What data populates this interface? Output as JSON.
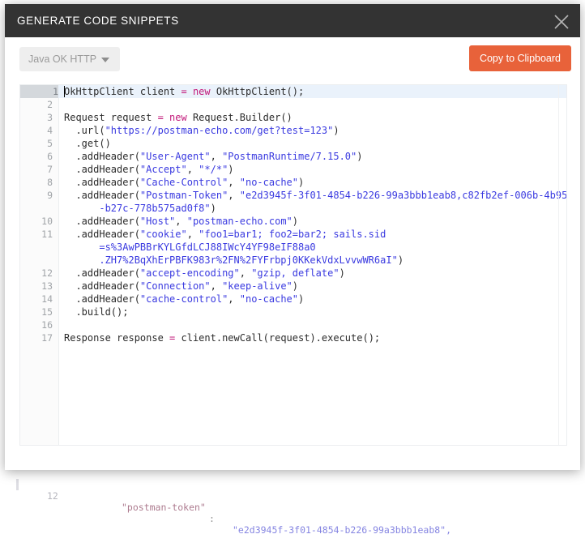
{
  "modal": {
    "title": "GENERATE CODE SNIPPETS",
    "close_icon": "close-icon"
  },
  "toolbar": {
    "language_selected": "Java OK HTTP",
    "language_caret_icon": "chevron-down-icon",
    "copy_label": "Copy to Clipboard",
    "accent_color": "#e8623a"
  },
  "editor": {
    "active_line": 1,
    "total_lines": 17,
    "lines": [
      {
        "num": "1",
        "active": true,
        "tokens": [
          {
            "t": "OkHttpClient client ",
            "c": "t-pln"
          },
          {
            "t": "= ",
            "c": "t-kw"
          },
          {
            "t": "new ",
            "c": "t-kw"
          },
          {
            "t": "OkHttpClient();",
            "c": "t-pln"
          }
        ]
      },
      {
        "num": "2",
        "active": false,
        "tokens": []
      },
      {
        "num": "3",
        "active": false,
        "tokens": [
          {
            "t": "Request request ",
            "c": "t-pln"
          },
          {
            "t": "= ",
            "c": "t-kw"
          },
          {
            "t": "new ",
            "c": "t-kw"
          },
          {
            "t": "Request.Builder()",
            "c": "t-pln"
          }
        ]
      },
      {
        "num": "4",
        "active": false,
        "tokens": [
          {
            "t": "  .url(",
            "c": "t-pln"
          },
          {
            "t": "\"https://postman-echo.com/get?test=123\"",
            "c": "t-str"
          },
          {
            "t": ")",
            "c": "t-pln"
          }
        ]
      },
      {
        "num": "5",
        "active": false,
        "tokens": [
          {
            "t": "  .get()",
            "c": "t-pln"
          }
        ]
      },
      {
        "num": "6",
        "active": false,
        "tokens": [
          {
            "t": "  .addHeader(",
            "c": "t-pln"
          },
          {
            "t": "\"User-Agent\"",
            "c": "t-str"
          },
          {
            "t": ", ",
            "c": "t-pln"
          },
          {
            "t": "\"PostmanRuntime/7.15.0\"",
            "c": "t-str"
          },
          {
            "t": ")",
            "c": "t-pln"
          }
        ]
      },
      {
        "num": "7",
        "active": false,
        "tokens": [
          {
            "t": "  .addHeader(",
            "c": "t-pln"
          },
          {
            "t": "\"Accept\"",
            "c": "t-str"
          },
          {
            "t": ", ",
            "c": "t-pln"
          },
          {
            "t": "\"*/*\"",
            "c": "t-str"
          },
          {
            "t": ")",
            "c": "t-pln"
          }
        ]
      },
      {
        "num": "8",
        "active": false,
        "tokens": [
          {
            "t": "  .addHeader(",
            "c": "t-pln"
          },
          {
            "t": "\"Cache-Control\"",
            "c": "t-str"
          },
          {
            "t": ", ",
            "c": "t-pln"
          },
          {
            "t": "\"no-cache\"",
            "c": "t-str"
          },
          {
            "t": ")",
            "c": "t-pln"
          }
        ]
      },
      {
        "num": "9",
        "active": false,
        "tokens": [
          {
            "t": "  .addHeader(",
            "c": "t-pln"
          },
          {
            "t": "\"Postman-Token\"",
            "c": "t-str"
          },
          {
            "t": ", ",
            "c": "t-pln"
          },
          {
            "t": "\"e2d3945f-3f01-4854-b226-99a3bbb1eab8,c82fb2ef-006b-4b95",
            "c": "t-str"
          }
        ]
      },
      {
        "num": "",
        "active": false,
        "tokens": [
          {
            "t": "      -b27c-778b575ad0f8\"",
            "c": "t-str"
          },
          {
            "t": ")",
            "c": "t-pln"
          }
        ]
      },
      {
        "num": "10",
        "active": false,
        "tokens": [
          {
            "t": "  .addHeader(",
            "c": "t-pln"
          },
          {
            "t": "\"Host\"",
            "c": "t-str"
          },
          {
            "t": ", ",
            "c": "t-pln"
          },
          {
            "t": "\"postman-echo.com\"",
            "c": "t-str"
          },
          {
            "t": ")",
            "c": "t-pln"
          }
        ]
      },
      {
        "num": "11",
        "active": false,
        "tokens": [
          {
            "t": "  .addHeader(",
            "c": "t-pln"
          },
          {
            "t": "\"cookie\"",
            "c": "t-str"
          },
          {
            "t": ", ",
            "c": "t-pln"
          },
          {
            "t": "\"foo1=bar1; foo2=bar2; sails.sid",
            "c": "t-str"
          }
        ]
      },
      {
        "num": "",
        "active": false,
        "tokens": [
          {
            "t": "      =s%3AwPBBrKYLGfdLCJ88IWcY4YF98eIF88a0",
            "c": "t-str"
          }
        ]
      },
      {
        "num": "",
        "active": false,
        "tokens": [
          {
            "t": "      .ZH7%2BqXhErPBFK983r%2FN%2FYFrbpj0KKekVdxLvvwWR6aI\"",
            "c": "t-str"
          },
          {
            "t": ")",
            "c": "t-pln"
          }
        ]
      },
      {
        "num": "12",
        "active": false,
        "tokens": [
          {
            "t": "  .addHeader(",
            "c": "t-pln"
          },
          {
            "t": "\"accept-encoding\"",
            "c": "t-str"
          },
          {
            "t": ", ",
            "c": "t-pln"
          },
          {
            "t": "\"gzip, deflate\"",
            "c": "t-str"
          },
          {
            "t": ")",
            "c": "t-pln"
          }
        ]
      },
      {
        "num": "13",
        "active": false,
        "tokens": [
          {
            "t": "  .addHeader(",
            "c": "t-pln"
          },
          {
            "t": "\"Connection\"",
            "c": "t-str"
          },
          {
            "t": ", ",
            "c": "t-pln"
          },
          {
            "t": "\"keep-alive\"",
            "c": "t-str"
          },
          {
            "t": ")",
            "c": "t-pln"
          }
        ]
      },
      {
        "num": "14",
        "active": false,
        "tokens": [
          {
            "t": "  .addHeader(",
            "c": "t-pln"
          },
          {
            "t": "\"cache-control\"",
            "c": "t-str"
          },
          {
            "t": ", ",
            "c": "t-pln"
          },
          {
            "t": "\"no-cache\"",
            "c": "t-str"
          },
          {
            "t": ")",
            "c": "t-pln"
          }
        ]
      },
      {
        "num": "15",
        "active": false,
        "tokens": [
          {
            "t": "  .build();",
            "c": "t-pln"
          }
        ]
      },
      {
        "num": "16",
        "active": false,
        "tokens": []
      },
      {
        "num": "17",
        "active": false,
        "tokens": [
          {
            "t": "Response response ",
            "c": "t-pln"
          },
          {
            "t": "= ",
            "c": "t-kw"
          },
          {
            "t": "client.newCall(request).execute();",
            "c": "t-pln"
          }
        ]
      }
    ]
  },
  "background": {
    "line_number": "12",
    "key": "\"postman-token\"",
    "separator": ":",
    "value": "\"e2d3945f-3f01-4854-b226-99a3bbb1eab8\","
  }
}
